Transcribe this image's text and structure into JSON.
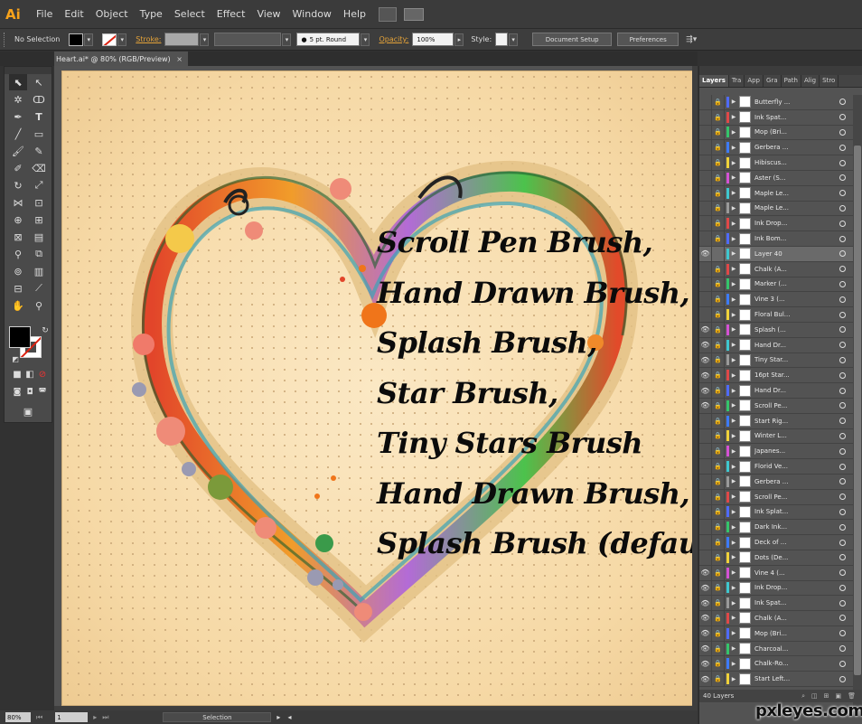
{
  "app": {
    "logo": "Ai"
  },
  "menu": [
    "File",
    "Edit",
    "Object",
    "Type",
    "Select",
    "Effect",
    "View",
    "Window",
    "Help"
  ],
  "control": {
    "selection": "No Selection",
    "stroke_label": "Stroke:",
    "brush_value": "5 pt. Round",
    "opacity_label": "Opacity:",
    "opacity_value": "100%",
    "style_label": "Style:",
    "document_setup": "Document Setup",
    "preferences": "Preferences"
  },
  "document": {
    "tab_title": "Heart.ai* @ 80% (RGB/Preview)",
    "close": "×"
  },
  "artwork": {
    "lines": [
      "Scroll Pen Brush,",
      "Hand Drawn Brush,",
      "Splash Brush,",
      "Star Brush,",
      "Tiny Stars Brush",
      "Hand Drawn Brush,",
      "Splash Brush (default)"
    ]
  },
  "status": {
    "zoom": "80%",
    "page": "1",
    "tool": "Selection"
  },
  "layers_panel": {
    "tabs": [
      "Layers",
      "Tra",
      "App",
      "Gra",
      "Path",
      "Alig",
      "Stro"
    ],
    "footer": "40 Layers",
    "layers": [
      {
        "name": "Butterfly ...",
        "eye": false,
        "lock": true,
        "color": "#4f6bff"
      },
      {
        "name": "Ink Spat...",
        "eye": false,
        "lock": true,
        "color": "#e04848"
      },
      {
        "name": "Mop (Bri...",
        "eye": false,
        "lock": true,
        "color": "#35c46b"
      },
      {
        "name": "Gerbera ...",
        "eye": false,
        "lock": true,
        "color": "#3d7bff"
      },
      {
        "name": "Hibiscus...",
        "eye": false,
        "lock": true,
        "color": "#f0d23a"
      },
      {
        "name": "Aster (S...",
        "eye": false,
        "lock": true,
        "color": "#d452d4"
      },
      {
        "name": "Maple Le...",
        "eye": false,
        "lock": true,
        "color": "#3fc7cf"
      },
      {
        "name": "Maple Le...",
        "eye": false,
        "lock": true,
        "color": "#9a9a9a"
      },
      {
        "name": "Ink Drop...",
        "eye": false,
        "lock": true,
        "color": "#e04848"
      },
      {
        "name": "Ink Bom...",
        "eye": false,
        "lock": true,
        "color": "#4f6bff"
      },
      {
        "name": "Layer 40",
        "eye": true,
        "lock": false,
        "color": "#3fc7cf",
        "selected": true
      },
      {
        "name": "Chalk (A...",
        "eye": false,
        "lock": true,
        "color": "#e04848"
      },
      {
        "name": "Marker (...",
        "eye": false,
        "lock": true,
        "color": "#35c46b"
      },
      {
        "name": "Vine 3 (...",
        "eye": false,
        "lock": true,
        "color": "#3d7bff"
      },
      {
        "name": "Floral Bul...",
        "eye": false,
        "lock": true,
        "color": "#f0d23a"
      },
      {
        "name": "Splash (...",
        "eye": true,
        "lock": true,
        "color": "#d452d4"
      },
      {
        "name": "Hand Dr...",
        "eye": true,
        "lock": true,
        "color": "#3fc7cf"
      },
      {
        "name": "Tiny Star...",
        "eye": true,
        "lock": true,
        "color": "#9a9a9a"
      },
      {
        "name": "16pt Star...",
        "eye": true,
        "lock": true,
        "color": "#e04848"
      },
      {
        "name": "Hand Dr...",
        "eye": true,
        "lock": true,
        "color": "#4f6bff"
      },
      {
        "name": "Scroll Pe...",
        "eye": true,
        "lock": true,
        "color": "#35c46b"
      },
      {
        "name": "Start Rig...",
        "eye": false,
        "lock": true,
        "color": "#3d7bff"
      },
      {
        "name": "Winter L...",
        "eye": false,
        "lock": true,
        "color": "#f0d23a"
      },
      {
        "name": "Japanes...",
        "eye": false,
        "lock": true,
        "color": "#d452d4"
      },
      {
        "name": "Florid Ve...",
        "eye": false,
        "lock": true,
        "color": "#3fc7cf"
      },
      {
        "name": "Gerbera ...",
        "eye": false,
        "lock": true,
        "color": "#9a9a9a"
      },
      {
        "name": "Scroll Pe...",
        "eye": false,
        "lock": true,
        "color": "#e04848"
      },
      {
        "name": "Ink Splat...",
        "eye": false,
        "lock": true,
        "color": "#4f6bff"
      },
      {
        "name": "Dark Ink...",
        "eye": false,
        "lock": true,
        "color": "#35c46b"
      },
      {
        "name": "Deck of ...",
        "eye": false,
        "lock": true,
        "color": "#3d7bff"
      },
      {
        "name": "Dots (De...",
        "eye": false,
        "lock": true,
        "color": "#f0d23a"
      },
      {
        "name": "Vine 4 (...",
        "eye": true,
        "lock": true,
        "color": "#d452d4"
      },
      {
        "name": "Ink Drop...",
        "eye": true,
        "lock": true,
        "color": "#3fc7cf"
      },
      {
        "name": "Ink Spat...",
        "eye": true,
        "lock": true,
        "color": "#9a9a9a"
      },
      {
        "name": "Chalk (A...",
        "eye": true,
        "lock": true,
        "color": "#e04848"
      },
      {
        "name": "Mop (Bri...",
        "eye": true,
        "lock": true,
        "color": "#4f6bff"
      },
      {
        "name": "Charcoal...",
        "eye": true,
        "lock": true,
        "color": "#35c46b"
      },
      {
        "name": "Chalk-Ro...",
        "eye": true,
        "lock": true,
        "color": "#3d7bff"
      },
      {
        "name": "Start Left...",
        "eye": true,
        "lock": true,
        "color": "#f0d23a"
      }
    ]
  },
  "watermark": "pxleyes.com"
}
